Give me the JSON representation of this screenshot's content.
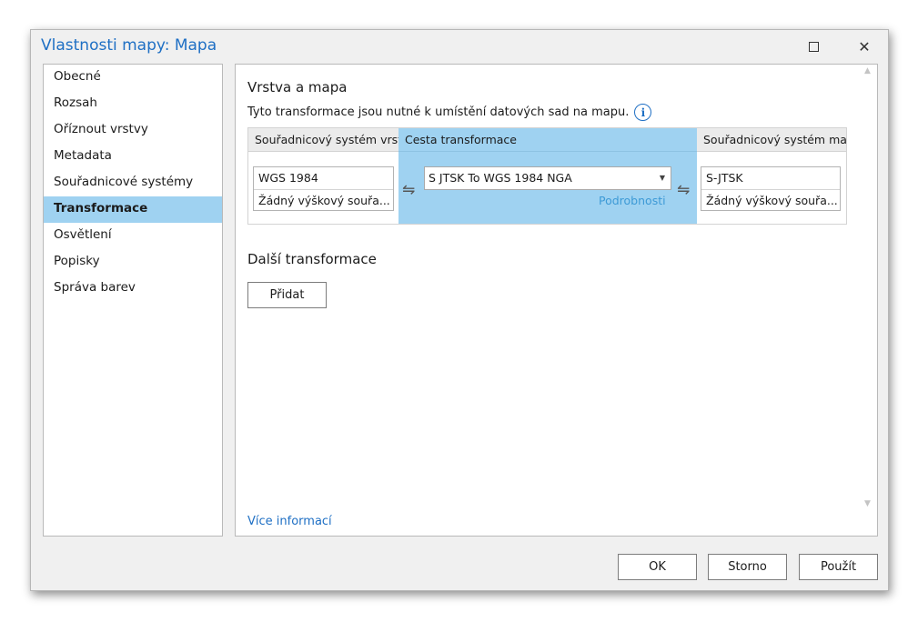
{
  "window": {
    "title": "Vlastnosti mapy: Mapa",
    "maximize_icon": "maximize-icon",
    "close_icon": "close-icon",
    "close_glyph": "✕"
  },
  "sidebar": {
    "items": [
      {
        "label": "Obecné",
        "active": false
      },
      {
        "label": "Rozsah",
        "active": false
      },
      {
        "label": "Oříznout vrstvy",
        "active": false
      },
      {
        "label": "Metadata",
        "active": false
      },
      {
        "label": "Souřadnicové systémy",
        "active": false
      },
      {
        "label": "Transformace",
        "active": true
      },
      {
        "label": "Osvětlení",
        "active": false
      },
      {
        "label": "Popisky",
        "active": false
      },
      {
        "label": "Správa barev",
        "active": false
      }
    ]
  },
  "main": {
    "section_title": "Vrstva a mapa",
    "description": "Tyto transformace jsou nutné k umístění datových sad na mapu.",
    "info_glyph": "i",
    "table": {
      "col_layer_header": "Souřadnicový systém vrstvy",
      "col_path_header": "Cesta transformace",
      "col_map_header": "Souřadnicový systém mapy",
      "layer_crs": "WGS 1984",
      "layer_vcs": "Žádný výškový souřa...",
      "path_value": "S JTSK To WGS 1984 NGA",
      "details_link": "Podrobnosti",
      "map_crs": "S-JTSK",
      "map_vcs": "Žádný výškový souřa...",
      "swap_glyph": "⇋",
      "caret_glyph": "▼"
    },
    "additional_title": "Další transformace",
    "add_button": "Přidat",
    "more_info_link": "Více informací",
    "scroll_up_glyph": "▲",
    "scroll_down_glyph": "▼"
  },
  "footer": {
    "ok": "OK",
    "cancel": "Storno",
    "apply": "Použít"
  },
  "colors": {
    "accent": "#1e6fc4",
    "selection": "#9fd2f1",
    "link_light": "#3d9ad6"
  }
}
